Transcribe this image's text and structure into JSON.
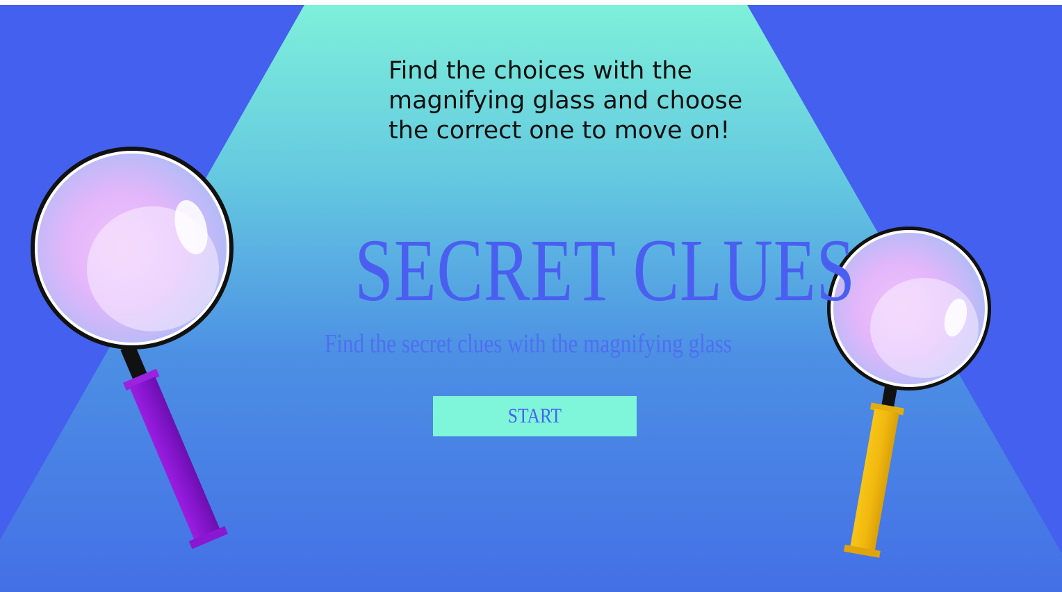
{
  "instruction": {
    "line1": "Find the choices with the",
    "line2": "magnifying glass and choose",
    "line3": "the correct one to move on!"
  },
  "title": "SECRET CLUES",
  "subtitle": "Find the secret clues with the magnifying glass",
  "start_label": "START",
  "colors": {
    "background": "#4460ee",
    "spotlight_top": "#7ef0da",
    "spotlight_bottom": "#4470e6",
    "title": "#4a5ff0",
    "button": "#7ff5d9",
    "left_handle": "#8a17d2",
    "right_handle": "#f2b90f"
  },
  "icons": {
    "left": "magnifying-glass-icon",
    "right": "magnifying-glass-icon"
  }
}
